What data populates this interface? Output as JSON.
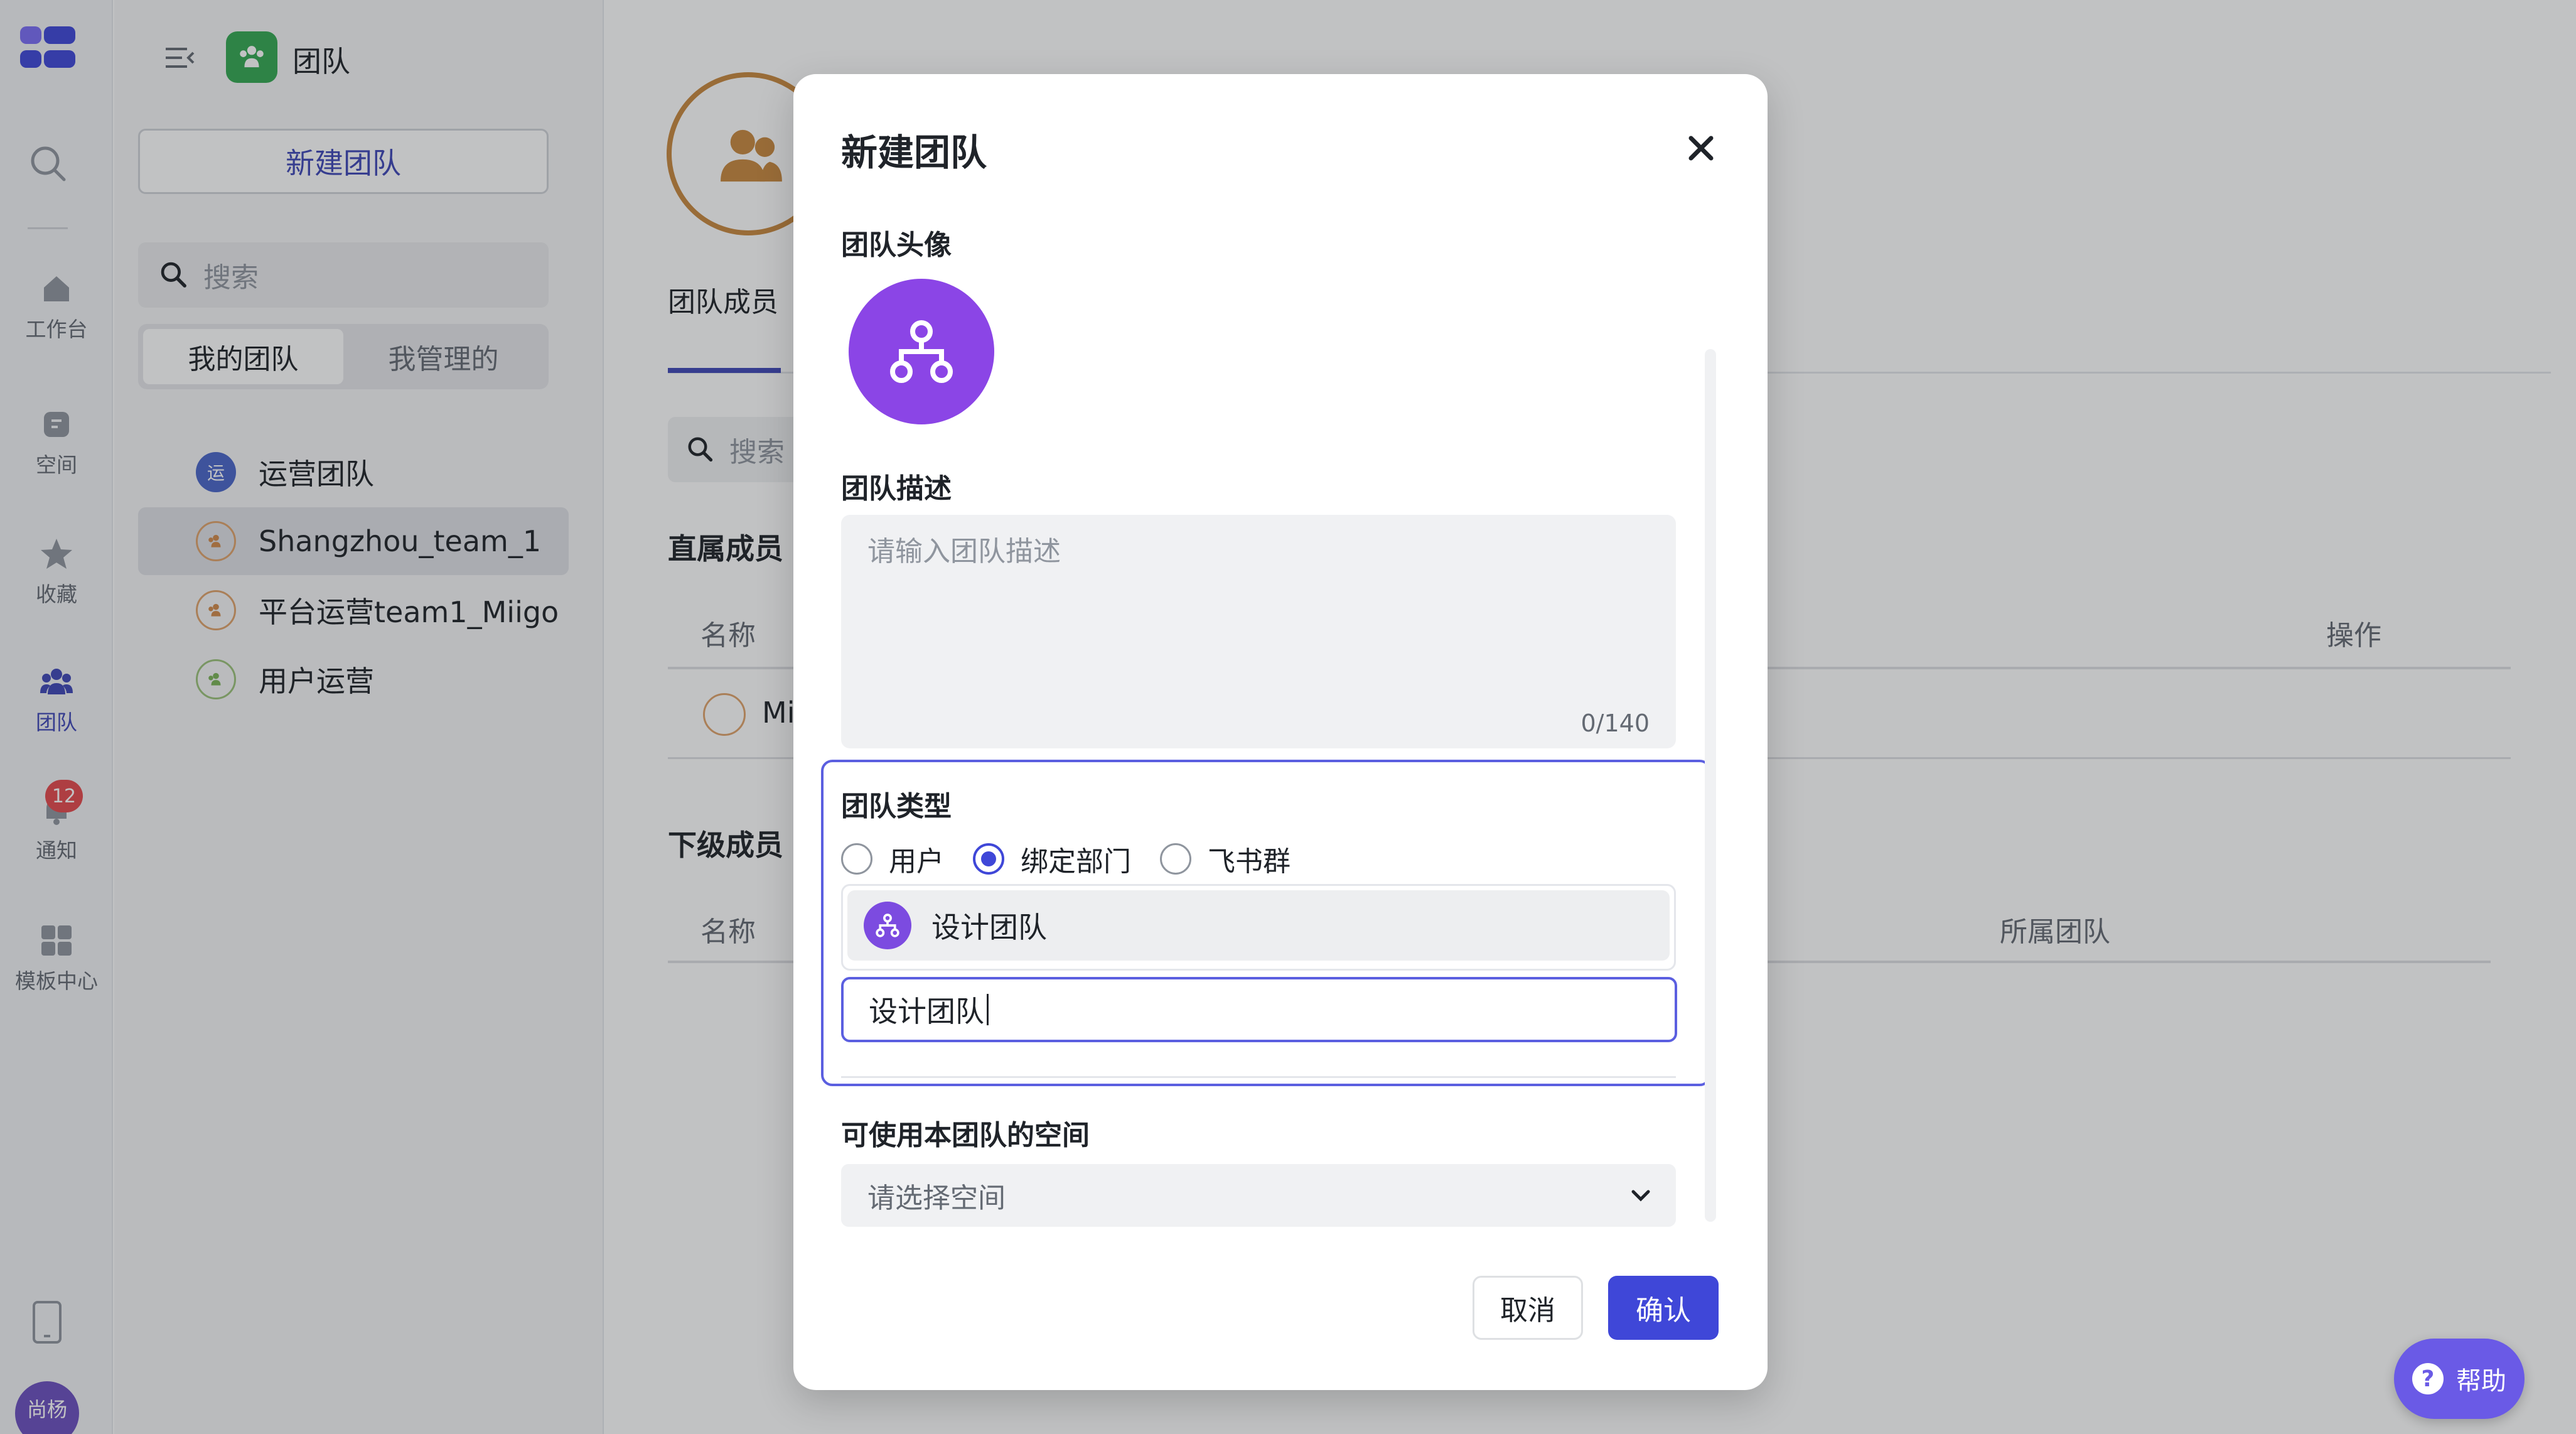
{
  "rail": {
    "items": [
      {
        "label": "工作台",
        "icon": "home-icon"
      },
      {
        "label": "空间",
        "icon": "space-icon"
      },
      {
        "label": "收藏",
        "icon": "star-icon"
      },
      {
        "label": "团队",
        "icon": "team-icon"
      },
      {
        "label": "通知",
        "icon": "bell-icon",
        "badge": "12"
      },
      {
        "label": "模板中心",
        "icon": "template-icon"
      }
    ],
    "user_avatar": "尚杨"
  },
  "sidebar": {
    "title": "团队",
    "new_team_button": "新建团队",
    "search_placeholder": "搜索",
    "segments": [
      "我的团队",
      "我管理的"
    ],
    "teams": [
      {
        "name": "运营团队",
        "avatar_text": "运"
      },
      {
        "name": "Shangzhou_team_1"
      },
      {
        "name": "平台运营team1_Miigo"
      },
      {
        "name": "用户运营"
      }
    ]
  },
  "main": {
    "tab_members": "团队成员",
    "search_placeholder": "搜索",
    "direct_members_title": "直属成员",
    "col_name": "名称",
    "col_action": "操作",
    "row_name_partial": "Mi",
    "sub_members_title": "下级成员",
    "col_name2": "名称",
    "col_team": "所属团队"
  },
  "modal": {
    "title": "新建团队",
    "avatar_label": "团队头像",
    "desc_label": "团队描述",
    "desc_placeholder": "请输入团队描述",
    "desc_count": "0/140",
    "type_label": "团队类型",
    "type_options": [
      "用户",
      "绑定部门",
      "飞书群"
    ],
    "type_selected": "绑定部门",
    "selected_dept": "设计团队",
    "search_value": "设计团队",
    "space_label": "可使用本团队的空间",
    "space_placeholder": "请选择空间",
    "cancel": "取消",
    "confirm": "确认"
  },
  "help": {
    "label": "帮助"
  },
  "colors": {
    "accent": "#3f47d8",
    "avatar_purple": "#8b45e6",
    "orange": "#c8883f"
  }
}
